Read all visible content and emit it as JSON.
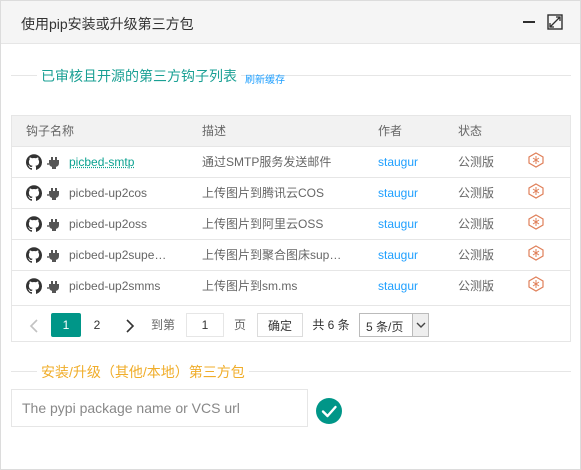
{
  "dialog": {
    "title": "使用pip安装或升级第三方包"
  },
  "list_section": {
    "legend": "已审核且开源的第三方钩子列表",
    "refresh_link": "刷新缓存"
  },
  "table": {
    "headers": [
      "钩子名称",
      "描述",
      "作者",
      "状态"
    ],
    "rows": [
      {
        "name": "picbed-smtp",
        "desc": "通过SMTP服务发送邮件",
        "author": "staugur",
        "status": "公测版",
        "highlighted": true
      },
      {
        "name": "picbed-up2cos",
        "desc": "上传图片到腾讯云COS",
        "author": "staugur",
        "status": "公测版",
        "highlighted": false
      },
      {
        "name": "picbed-up2oss",
        "desc": "上传图片到阿里云OSS",
        "author": "staugur",
        "status": "公测版",
        "highlighted": false
      },
      {
        "name": "picbed-up2supe…",
        "desc": "上传图片到聚合图床sup…",
        "author": "staugur",
        "status": "公测版",
        "highlighted": false
      },
      {
        "name": "picbed-up2smms",
        "desc": "上传图片到sm.ms",
        "author": "staugur",
        "status": "公测版",
        "highlighted": false
      }
    ]
  },
  "pager": {
    "prev": "‹",
    "current_page": "1",
    "page_2": "2",
    "next": "›",
    "goto_prefix": "到第",
    "goto_value": "1",
    "goto_suffix": "页",
    "confirm": "确定",
    "total": "共 6 条",
    "page_size": "5 条/页"
  },
  "install_section": {
    "legend": "安装/升级（其他/本地）第三方包",
    "placeholder": "The pypi package name or VCS url"
  },
  "colors": {
    "accent": "#009688",
    "legend_green": "#1aa094",
    "legend_orange": "#f0ad2a",
    "link_blue": "#1e9fff",
    "delete_icon": "#e0805a"
  }
}
